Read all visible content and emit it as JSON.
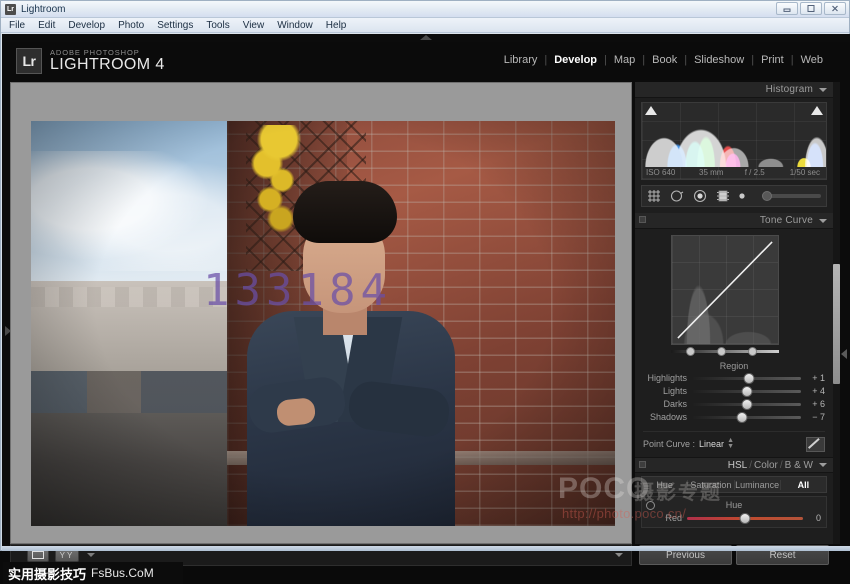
{
  "os": {
    "title": "Lightroom",
    "app_icon": "Lr",
    "window_buttons": [
      {
        "name": "minimize-button",
        "glyph": "minimize-icon"
      },
      {
        "name": "maximize-button",
        "glyph": "maximize-icon"
      },
      {
        "name": "close-button",
        "glyph": "close-icon"
      }
    ],
    "menu": [
      "File",
      "Edit",
      "Develop",
      "Photo",
      "Settings",
      "Tools",
      "View",
      "Window",
      "Help"
    ]
  },
  "identity": {
    "badge": "Lr",
    "sub": "ADOBE PHOTOSHOP",
    "main": "LIGHTROOM 4"
  },
  "modules": [
    {
      "label": "Library",
      "active": false
    },
    {
      "label": "Develop",
      "active": true
    },
    {
      "label": "Map",
      "active": false
    },
    {
      "label": "Book",
      "active": false
    },
    {
      "label": "Slideshow",
      "active": false
    },
    {
      "label": "Print",
      "active": false
    },
    {
      "label": "Web",
      "active": false
    }
  ],
  "photo": {
    "overlay_watermark": "133184"
  },
  "poco_watermark": {
    "brand": "POCO",
    "cn": "摄影专题",
    "url": "http://photo.poco.cn/"
  },
  "toolbar": {
    "loupe_label": "loupe-view",
    "compare_label": "YY",
    "caret": "caret-down-icon"
  },
  "histogram": {
    "title": "Histogram",
    "meta": [
      "ISO 640",
      "35 mm",
      "f / 2.5",
      "1/50 sec"
    ]
  },
  "tools": [
    {
      "name": "crop-overlay-icon"
    },
    {
      "name": "spot-removal-icon"
    },
    {
      "name": "red-eye-correction-icon"
    },
    {
      "name": "graduated-filter-icon"
    },
    {
      "name": "adjustment-brush-icon"
    }
  ],
  "tone_curve": {
    "title": "Tone Curve",
    "region_label": "Region",
    "sliders": [
      {
        "name": "Highlights",
        "value": "+ 1",
        "pos": 52
      },
      {
        "name": "Lights",
        "value": "+ 4",
        "pos": 50
      },
      {
        "name": "Darks",
        "value": "+ 6",
        "pos": 50
      },
      {
        "name": "Shadows",
        "value": "− 7",
        "pos": 45
      }
    ],
    "point_curve_label": "Point Curve :",
    "point_curve_value": "Linear",
    "split_points": [
      18,
      46,
      74
    ]
  },
  "hsl": {
    "title_hsl": "HSL",
    "title_color": "Color",
    "title_bw": "B & W",
    "sep": "/",
    "tabs": [
      {
        "label": "Hue",
        "active": false
      },
      {
        "label": "Saturation",
        "active": false
      },
      {
        "label": "Luminance",
        "active": false
      },
      {
        "label": "All",
        "active": true
      }
    ],
    "section_title": "Hue",
    "rows": [
      {
        "name": "Red",
        "value": "0",
        "pos": 50
      }
    ]
  },
  "buttons": {
    "previous": "Previous",
    "reset": "Reset"
  },
  "footer_watermark": {
    "cn": "实用摄影技巧",
    "en": "FsBus.CoM"
  }
}
